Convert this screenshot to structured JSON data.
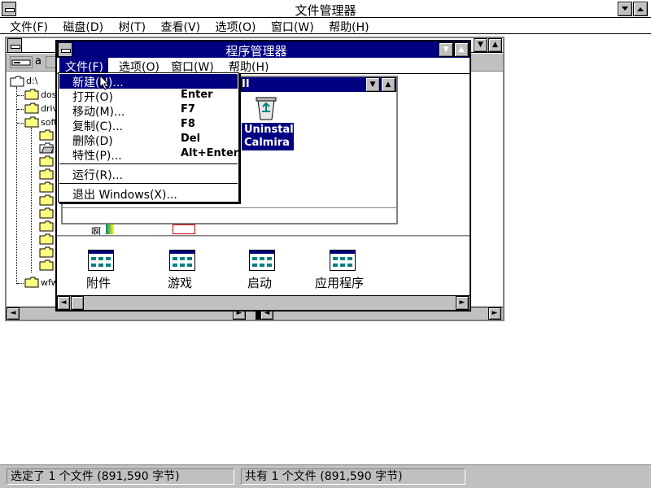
{
  "file_manager": {
    "title": "文件管理器",
    "menu": [
      "文件(F)",
      "磁盘(D)",
      "树(T)",
      "查看(V)",
      "选项(O)",
      "窗口(W)",
      "帮助(H)"
    ]
  },
  "drive_window": {
    "drive_letter": "a",
    "tree": [
      "d:\\",
      "dosv",
      "drive",
      "softv",
      "wfw"
    ]
  },
  "program_manager": {
    "title": "程序管理器",
    "menu": [
      "文件(F)",
      "选项(O)",
      "窗口(W)",
      "帮助(H)"
    ],
    "group_window_title": "II",
    "uninstall_label_1": "Uninstall",
    "uninstall_label_2": "Calmira II",
    "partial_icon_label": "啊",
    "groups": [
      "附件",
      "游戏",
      "启动",
      "应用程序"
    ]
  },
  "file_menu": {
    "items": [
      {
        "label": "新建(N)...",
        "shortcut": ""
      },
      {
        "label": "打开(O)",
        "shortcut": "Enter"
      },
      {
        "label": "移动(M)...",
        "shortcut": "F7"
      },
      {
        "label": "复制(C)...",
        "shortcut": "F8"
      },
      {
        "label": "删除(D)",
        "shortcut": "Del"
      },
      {
        "label": "特性(P)...",
        "shortcut": "Alt+Enter"
      },
      {
        "label": "运行(R)...",
        "shortcut": ""
      },
      {
        "label": "退出 Windows(X)...",
        "shortcut": ""
      }
    ]
  },
  "status": {
    "left": "选定了 1 个文件 (891,590 字节)",
    "right": "共有 1 个文件 (891,590 字节)"
  },
  "colors": {
    "title_active": "#000080",
    "face": "#c0c0c0",
    "teal": "#008080"
  },
  "icons": {
    "control_menu": "control-menu-icon",
    "minimize": "minimize-arrow-icon",
    "maximize": "maximize-arrow-icon",
    "folder": "folder-icon",
    "recycle": "recycle-bin-icon",
    "program_group": "program-group-icon"
  }
}
